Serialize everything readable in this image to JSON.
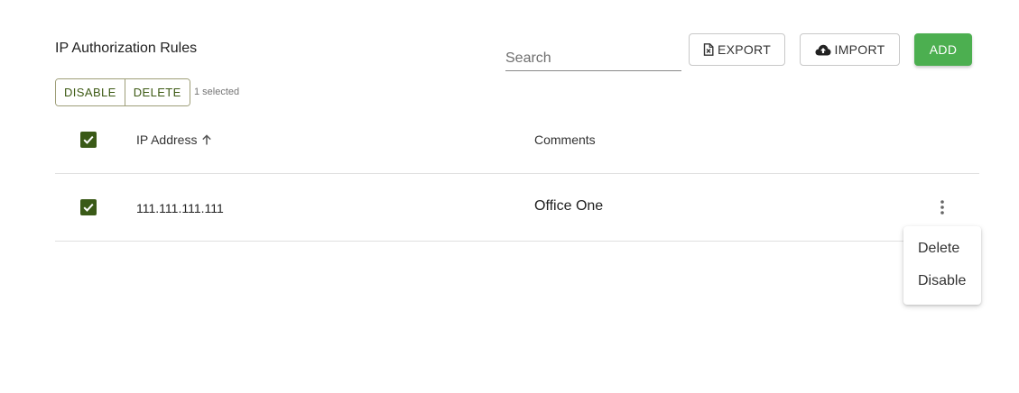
{
  "header": {
    "title": "IP Authorization Rules",
    "search_placeholder": "Search",
    "search_value": ""
  },
  "toolbar": {
    "export_label": "EXPORT",
    "import_label": "IMPORT",
    "add_label": "ADD",
    "add_color": "#4caf50"
  },
  "bulk_actions": {
    "disable_label": "DISABLE",
    "delete_label": "DELETE",
    "selected_text": "1 selected"
  },
  "table": {
    "columns": [
      {
        "label": "IP Address",
        "sort": "ascending"
      },
      {
        "label": "Comments"
      }
    ],
    "rows": [
      {
        "ip": "111.111.111.111",
        "comment": "Office One",
        "checked": true
      }
    ],
    "header_checked": true,
    "checkbox_color": "#3a5a17"
  },
  "row_menu": {
    "items": [
      {
        "label": "Delete"
      },
      {
        "label": "Disable"
      }
    ]
  },
  "icons": {
    "export": "file-export-icon",
    "import": "cloud-upload-icon",
    "sort": "arrow-up-icon",
    "more": "more-vertical-icon",
    "check": "check-icon"
  }
}
